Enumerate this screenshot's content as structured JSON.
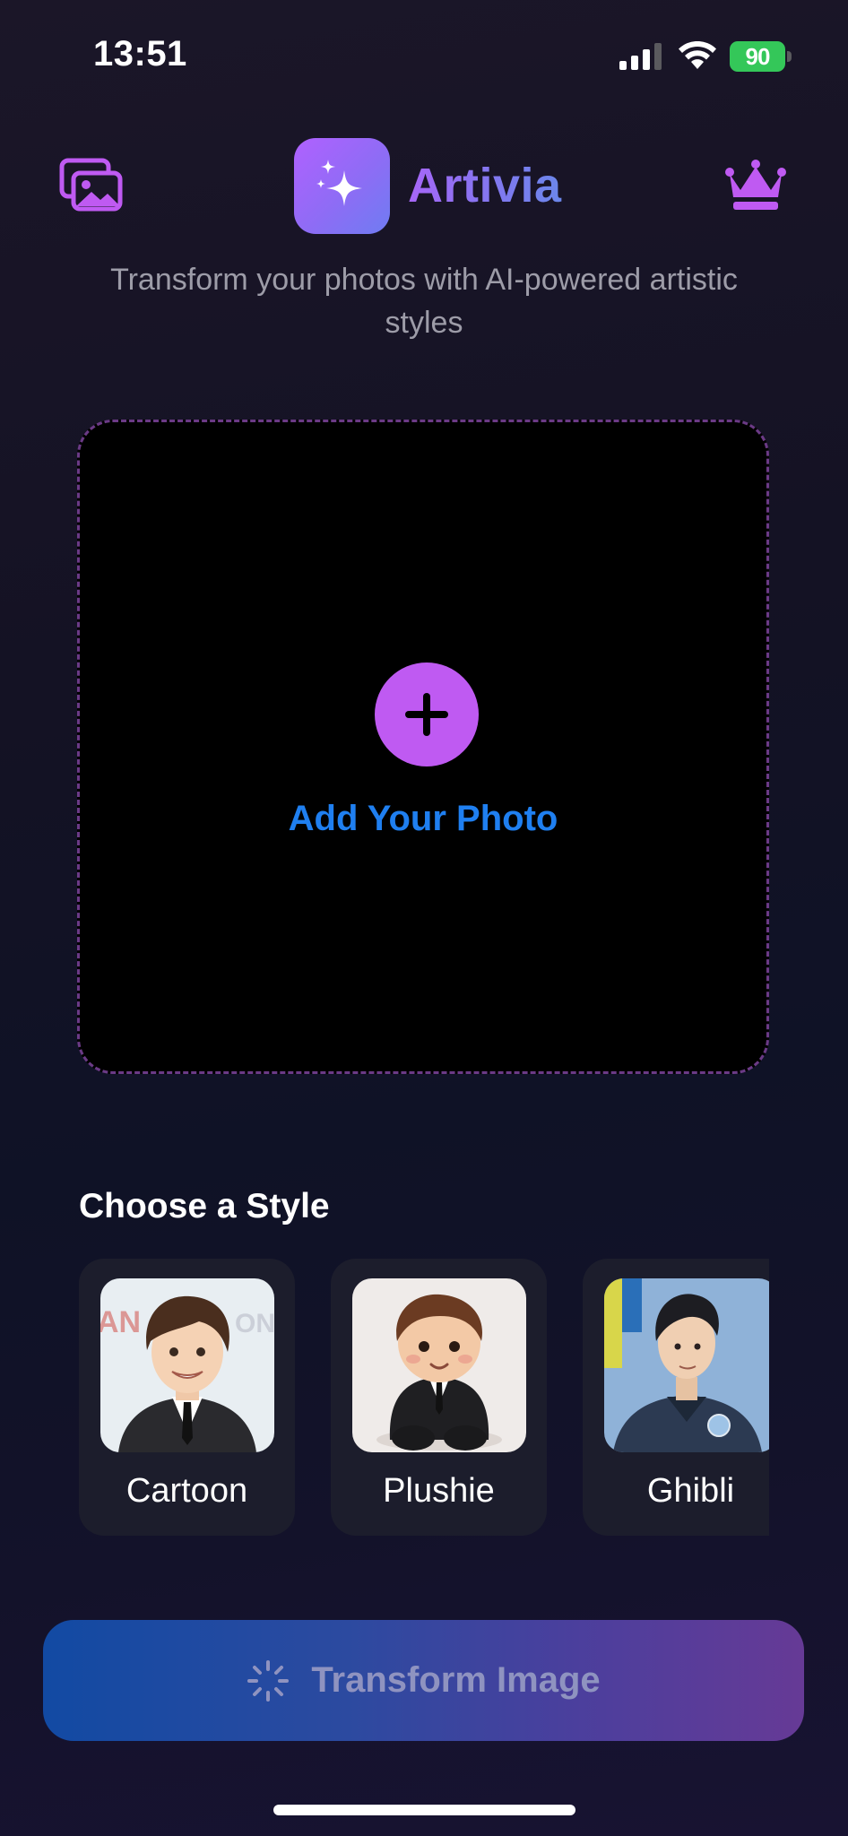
{
  "status_bar": {
    "time": "13:51",
    "battery": "90"
  },
  "header": {
    "app_name": "Artivia",
    "subtitle": "Transform your photos with AI-powered artistic styles",
    "left_icon": "photo-gallery-icon",
    "right_icon": "crown-icon"
  },
  "upload": {
    "label": "Add Your Photo",
    "icon": "plus-icon"
  },
  "styles": {
    "title": "Choose a Style",
    "items": [
      {
        "label": "Cartoon"
      },
      {
        "label": "Plushie"
      },
      {
        "label": "Ghibli"
      }
    ]
  },
  "action": {
    "label": "Transform Image",
    "icon": "sparkle-burst-icon"
  },
  "colors": {
    "accent_purple": "#bf5af2",
    "link_blue": "#1f7ff0",
    "battery_green": "#34c759"
  }
}
